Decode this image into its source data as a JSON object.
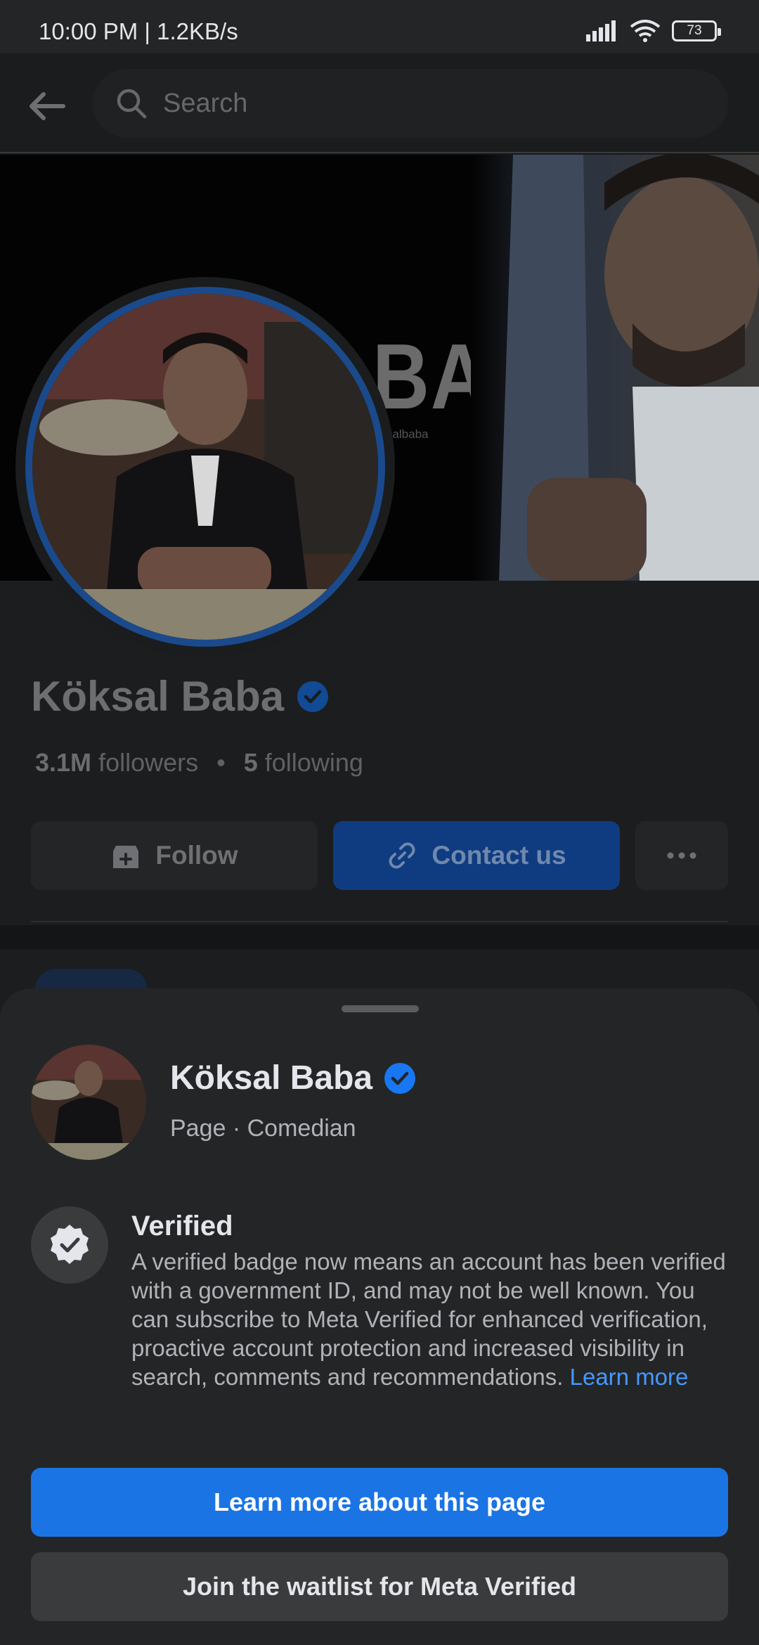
{
  "status_bar": {
    "time_speed": "10:00 PM | 1.2KB/s",
    "battery": "73",
    "icons": [
      "signal-icon",
      "wifi-icon",
      "battery-icon"
    ]
  },
  "topbar": {
    "back_icon": "back-arrow-icon",
    "search_placeholder": "Search"
  },
  "cover": {
    "big_text": "BA",
    "handle_text": "oksalbaba"
  },
  "profile": {
    "name": "Köksal Baba",
    "followers_count": "3.1M",
    "followers_label": "followers",
    "separator": "•",
    "following_count": "5",
    "following_label": "following",
    "buttons": {
      "follow": "Follow",
      "contact": "Contact us",
      "more_icon": "more-horizontal-icon"
    }
  },
  "sheet": {
    "name": "Köksal Baba",
    "subtitle": "Page · Comedian",
    "verified_title": "Verified",
    "verified_description": "A verified badge now means an account has been verified with a government ID, and may not be well known. You can subscribe to Meta Verified for enhanced verification, proactive account protection and increased visibility in search, comments and recommendations.",
    "learn_more_link": "Learn more",
    "primary_button": "Learn more about this page",
    "secondary_button": "Join the waitlist for Meta Verified"
  },
  "colors": {
    "accent": "#1b74e4",
    "link": "#4599ff",
    "sheet_bg": "#242526",
    "verified_badge": "#1877f2"
  }
}
